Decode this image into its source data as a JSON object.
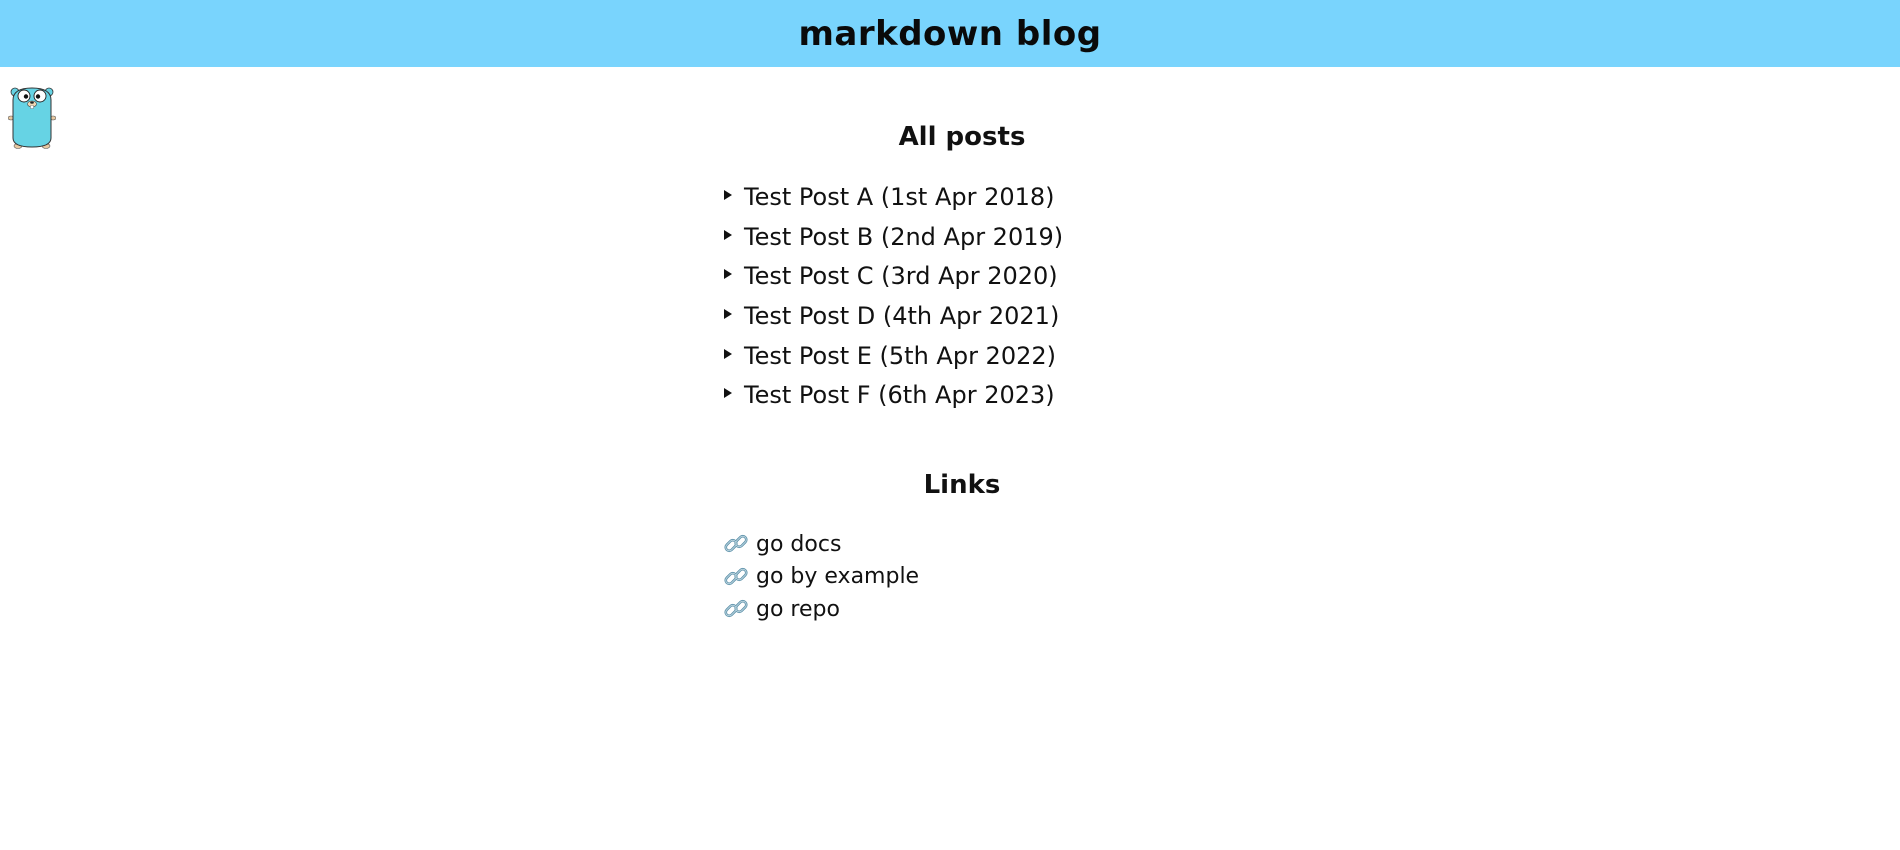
{
  "header": {
    "title": "markdown blog",
    "background_color": "#79d4fd"
  },
  "mascot": {
    "icon": "gopher-icon",
    "color": "#66d3e4"
  },
  "posts_section": {
    "title": "All posts",
    "posts": [
      {
        "label": "Test Post A (1st Apr 2018)"
      },
      {
        "label": "Test Post B (2nd Apr 2019)"
      },
      {
        "label": "Test Post C (3rd Apr 2020)"
      },
      {
        "label": "Test Post D (4th Apr 2021)"
      },
      {
        "label": "Test Post E (5th Apr 2022)"
      },
      {
        "label": "Test Post F (6th Apr 2023)"
      }
    ]
  },
  "links_section": {
    "title": "Links",
    "icon": "link-icon",
    "links": [
      {
        "label": "go docs"
      },
      {
        "label": "go by example"
      },
      {
        "label": "go repo"
      }
    ]
  }
}
